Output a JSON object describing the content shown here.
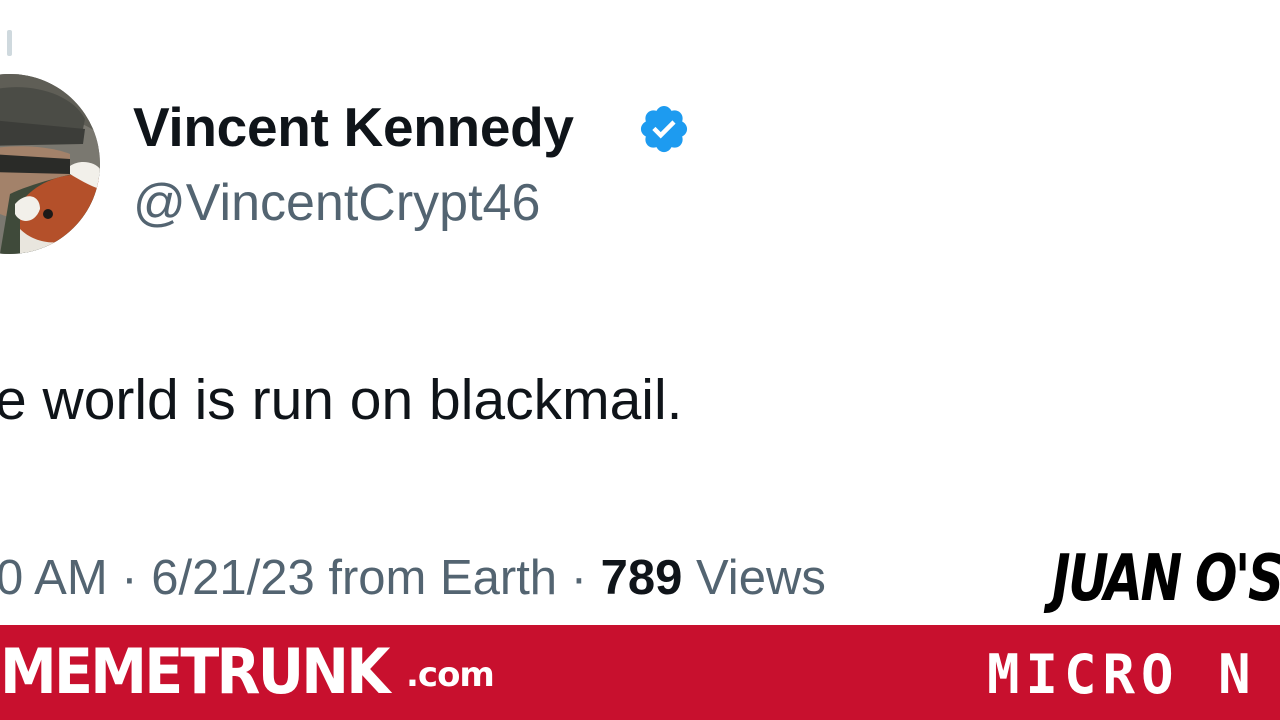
{
  "tweet": {
    "display_name": "Vincent Kennedy",
    "handle": "@VincentCrypt46",
    "verified_icon": "verified-badge-icon",
    "text": "e world is run on blackmail.",
    "meta": {
      "time": "0 AM",
      "separator": " · ",
      "date": "6/21/23",
      "source": " from Earth",
      "views_count": "789",
      "views_label": " Views"
    }
  },
  "overlay": {
    "corner_text": "JUAN O'S"
  },
  "banner": {
    "brand": "MEMETRUNK",
    "brand_tld": ".com",
    "right_text": "MICRO N"
  },
  "colors": {
    "verified_blue": "#1d9bf0",
    "banner_red": "#c8102e",
    "text_dark": "#0f1419",
    "text_gray": "#536471"
  }
}
